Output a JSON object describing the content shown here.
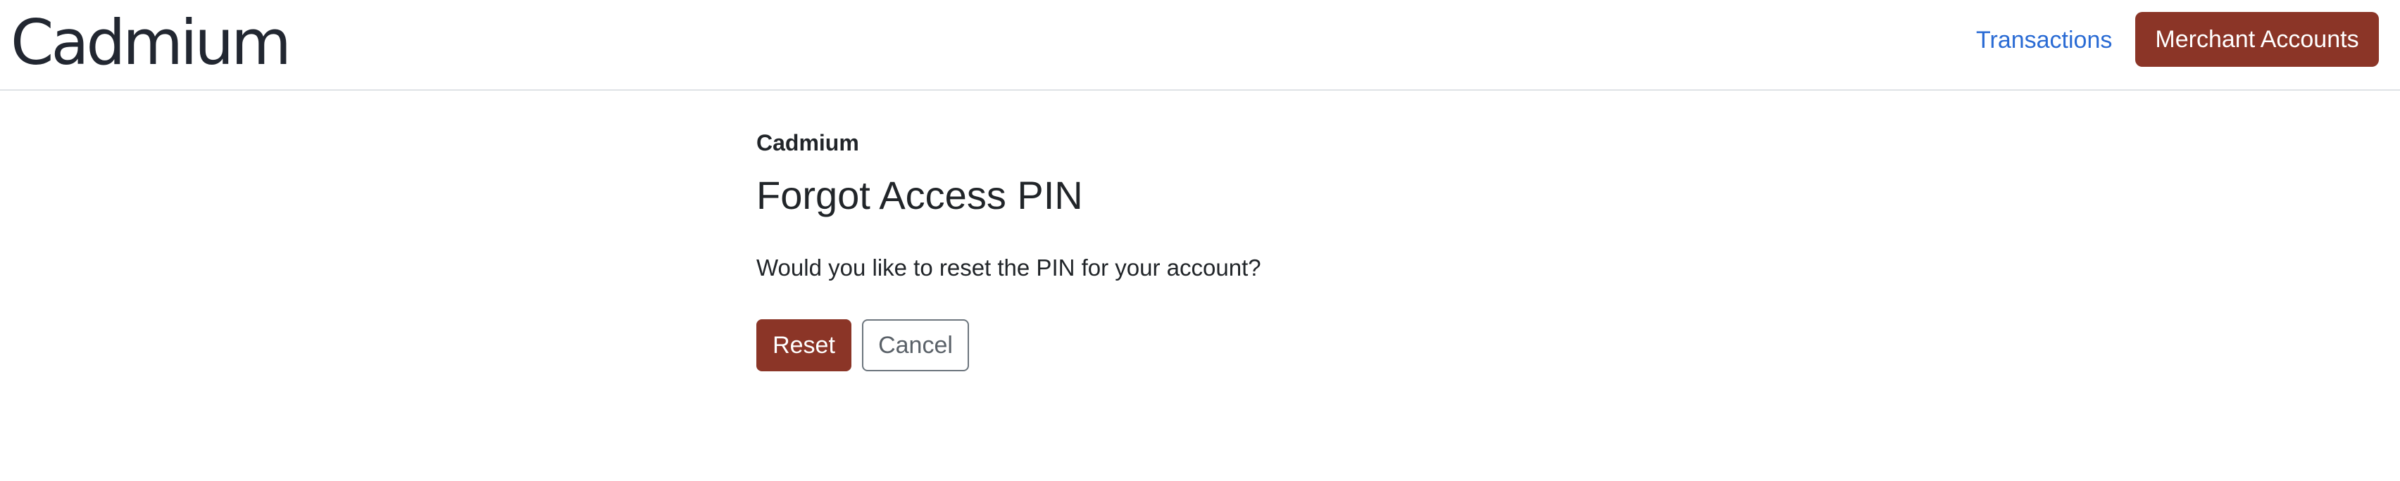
{
  "header": {
    "brand": "Cadmium",
    "nav_link": "Transactions",
    "nav_button": "Merchant Accounts"
  },
  "main": {
    "eyebrow": "Cadmium",
    "title": "Forgot Access PIN",
    "prompt": "Would you like to reset the PIN for your account?",
    "reset_label": "Reset",
    "cancel_label": "Cancel"
  },
  "colors": {
    "brand_accent": "#8b3527",
    "link": "#2a6bd4",
    "text": "#212529",
    "divider": "#dee2e6"
  }
}
